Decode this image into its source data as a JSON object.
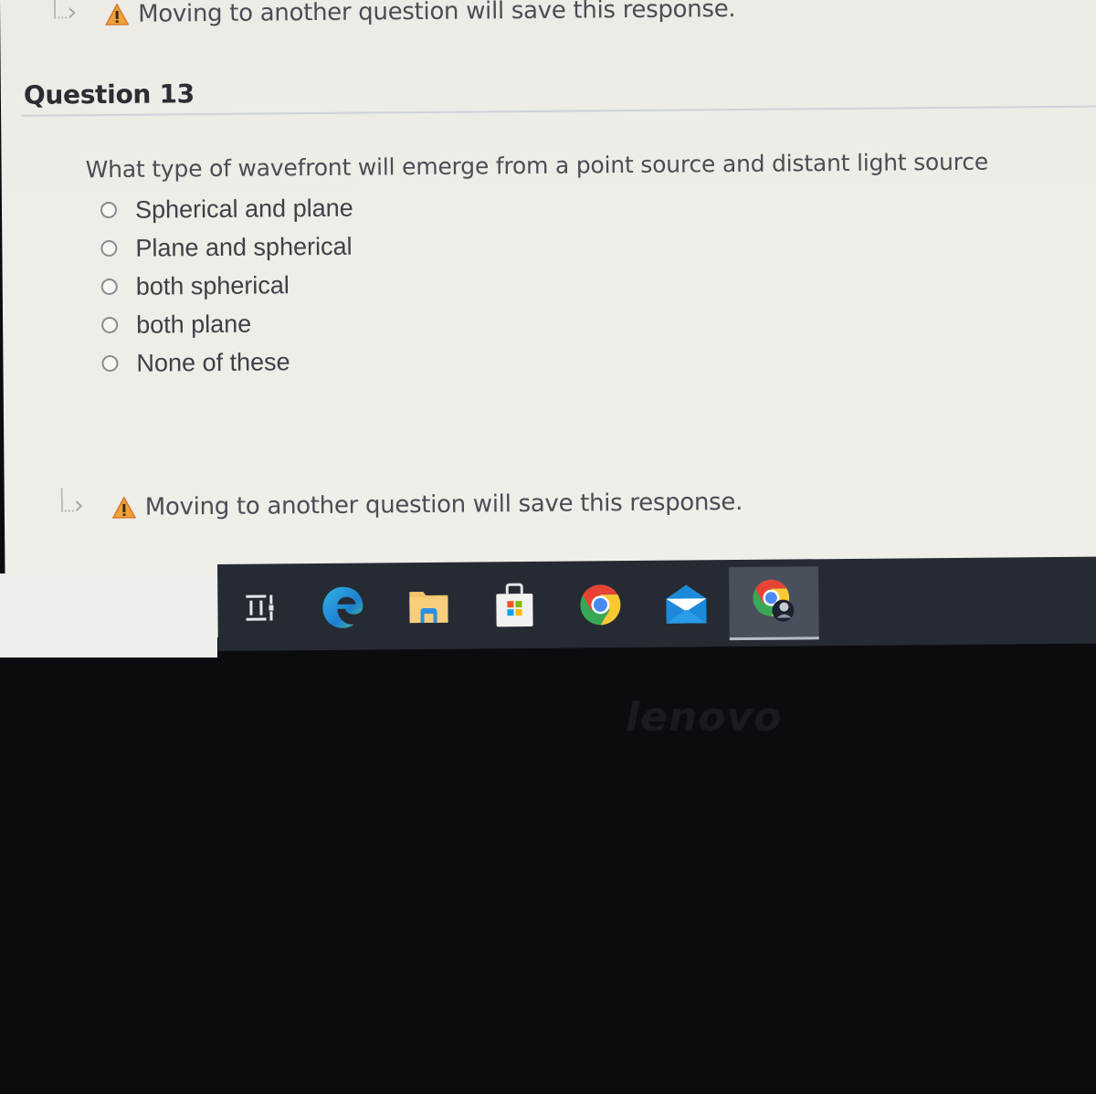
{
  "notice": {
    "text": "Moving to another question will save this response.",
    "icon": "warning-icon"
  },
  "question": {
    "title": "Question 13",
    "text": "What type of wavefront will emerge from a point source and distant light source",
    "options": [
      {
        "label": "Spherical and plane",
        "selected": false
      },
      {
        "label": "Plane and spherical",
        "selected": false
      },
      {
        "label": "both spherical",
        "selected": false
      },
      {
        "label": "both plane",
        "selected": false
      },
      {
        "label": "None of these",
        "selected": false
      }
    ]
  },
  "notice_bottom": {
    "text": "Moving to another question will save this response."
  },
  "taskbar": {
    "items": [
      {
        "name": "task-view-icon"
      },
      {
        "name": "edge-icon"
      },
      {
        "name": "file-explorer-icon"
      },
      {
        "name": "microsoft-store-icon"
      },
      {
        "name": "chrome-icon"
      },
      {
        "name": "mail-icon"
      },
      {
        "name": "chrome-profile-icon",
        "active": true
      }
    ]
  },
  "bezel": {
    "brand": "lenovo"
  },
  "colors": {
    "warning": "#f0a23a",
    "taskbar": "#262a33",
    "page_bg": "#eeede7"
  }
}
